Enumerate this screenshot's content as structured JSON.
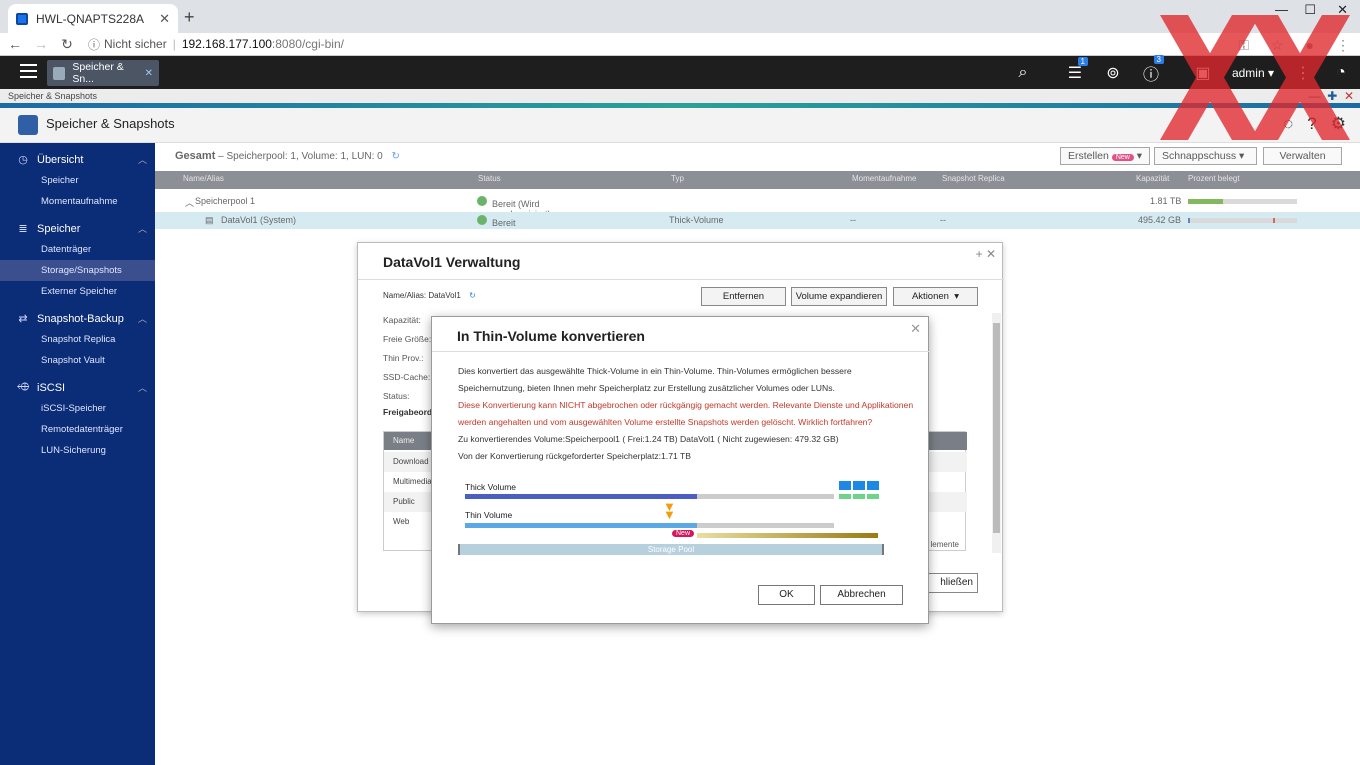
{
  "browser": {
    "tab_title": "HWL-QNAPTS228A",
    "insecure_label": "Nicht sicher",
    "url_host": "192.168.177.100",
    "url_path": ":8080/cgi-bin/"
  },
  "qts": {
    "app_tab_label": "Speicher & Sn...",
    "notification_badge": "1",
    "info_badge": "3",
    "user": "admin"
  },
  "app": {
    "window_title": "Speicher & Snapshots",
    "header_title": "Speicher & Snapshots"
  },
  "sidebar": {
    "groups": [
      {
        "label": "Übersicht",
        "items": [
          "Speicher",
          "Momentaufnahme"
        ]
      },
      {
        "label": "Speicher",
        "items": [
          "Datenträger",
          "Storage/Snapshots",
          "Externer Speicher"
        ]
      },
      {
        "label": "Snapshot-Backup",
        "items": [
          "Snapshot Replica",
          "Snapshot Vault"
        ]
      },
      {
        "label": "iSCSI",
        "items": [
          "iSCSI-Speicher",
          "Remotedatenträger",
          "LUN-Sicherung"
        ]
      }
    ],
    "active_item": "Storage/Snapshots"
  },
  "summary": {
    "label": "Gesamt",
    "details": "Speicherpool: 1, Volume: 1, LUN: 0",
    "buttons": {
      "create": "Erstellen",
      "create_badge": "New",
      "snapshot": "Schnappschuss",
      "manage": "Verwalten"
    }
  },
  "table": {
    "headers": [
      "Name/Alias",
      "Status",
      "Typ",
      "Momentaufnahme",
      "Snapshot Replica",
      "Kapazität",
      "Prozent belegt"
    ],
    "rows": [
      {
        "name": "Speicherpool 1",
        "status": "Bereit (Wird synchronisiert)",
        "type": "",
        "snap": "",
        "replica": "",
        "capacity": "1.81 TB",
        "percent": 0.32
      },
      {
        "name": "DataVol1 (System)",
        "status": "Bereit",
        "type": "Thick-Volume",
        "snap": "--",
        "replica": "--",
        "capacity": "495.42 GB",
        "percent": 0.8
      }
    ]
  },
  "mgmt": {
    "title": "DataVol1  Verwaltung",
    "alias_label": "Name/Alias:",
    "alias_value": "DataVol1",
    "buttons": {
      "remove": "Entfernen",
      "expand": "Volume expandieren",
      "actions": "Aktionen"
    },
    "labels": [
      "Kapazität:",
      "Freie Größe:",
      "Thin Prov.:",
      "SSD-Cache:",
      "Status:",
      "Freigabeordne"
    ],
    "share_header": "Name",
    "shares": [
      "Download",
      "Multimedia",
      "Public",
      "Web"
    ],
    "footer_text": "lemente",
    "close_label": "hließen"
  },
  "dialog": {
    "title": "In Thin-Volume konvertieren",
    "para1_line1": "Dies konvertiert das ausgewählte Thick-Volume in ein Thin-Volume. Thin-Volumes ermöglichen bessere",
    "para1_line2": "Speichernutzung, bieten Ihnen mehr Speicherplatz zur Erstellung zusätzlicher Volumes oder LUNs.",
    "warn_line1": "Diese Konvertierung kann NICHT abgebrochen oder rückgängig gemacht werden. Relevante Dienste und Applikationen",
    "warn_line2": "werden angehalten und vom ausgewählten Volume erstellte Snapshots werden gelöscht. Wirklich fortfahren?",
    "line_volume": "Zu konvertierendes Volume:Speicherpool1 ( Frei:1.24 TB) DataVol1 ( Nicht zugewiesen: 479.32 GB)",
    "line_reclaim": "Von der Konvertierung rückgeforderter Speicherplatz:1.71 TB",
    "illus": {
      "thick_label": "Thick Volume",
      "thin_label": "Thin Volume",
      "new_badge": "New",
      "pool_label": "Storage Pool"
    },
    "ok": "OK",
    "cancel": "Abbrechen"
  },
  "colors": {
    "sidebar": "#0b2c76",
    "accent": "#2b7de9",
    "warning": "#c0392b",
    "watermark": "#e0282d"
  }
}
